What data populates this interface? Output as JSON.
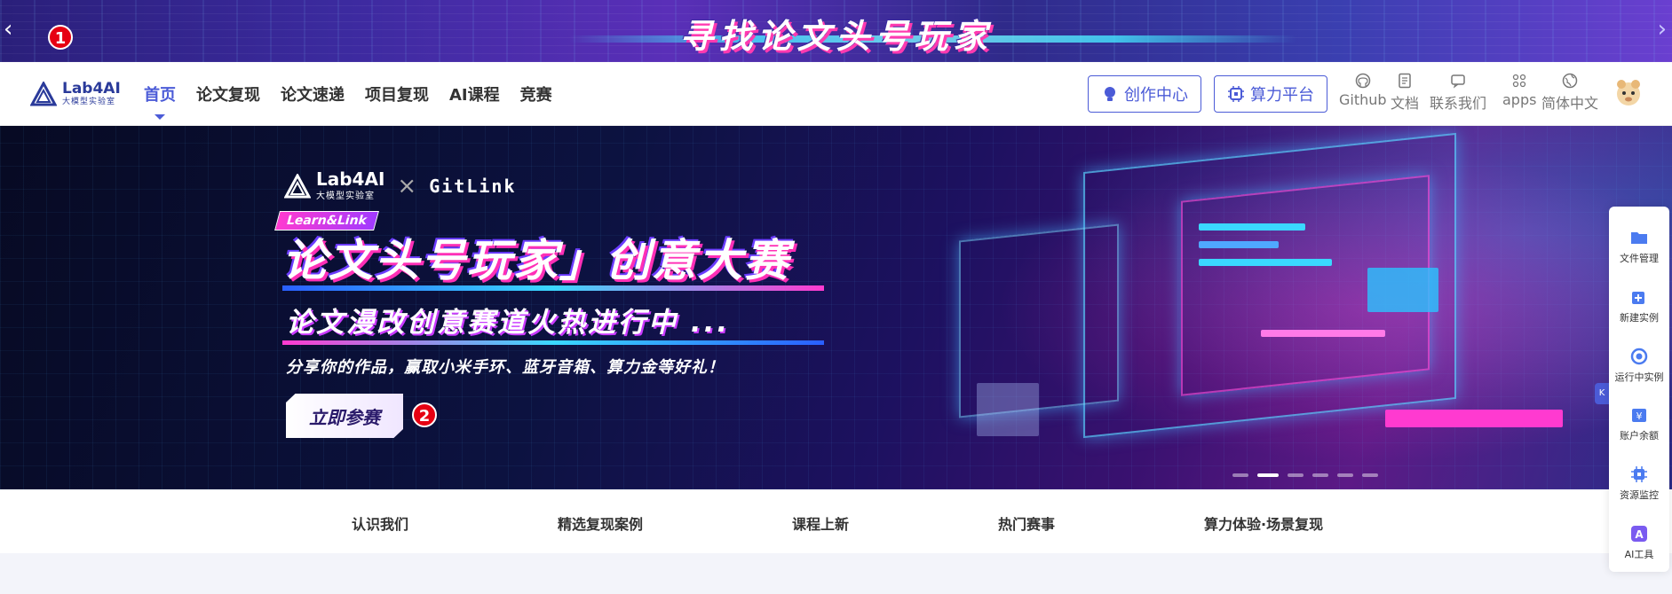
{
  "promo": {
    "title": "寻找论文头号玩家",
    "prev_icon": "chevron-left-icon",
    "next_icon": "chevron-right-icon",
    "badge": "1"
  },
  "nav": {
    "logo": {
      "name": "Lab4AI",
      "sub": "大模型实验室"
    },
    "menu": [
      {
        "label": "首页",
        "active": true
      },
      {
        "label": "论文复现"
      },
      {
        "label": "论文速递"
      },
      {
        "label": "项目复现"
      },
      {
        "label": "AI课程"
      },
      {
        "label": "竞赛"
      }
    ],
    "buttons": {
      "creator": "创作中心",
      "compute": "算力平台"
    },
    "tools": {
      "github": "Github",
      "docs": "文档",
      "contact": "联系我们",
      "apps": "apps",
      "lang": "简体中文"
    }
  },
  "hero": {
    "brand_name": "Lab4AI",
    "brand_sub": "大模型实验室",
    "times": "×",
    "gitlink_mark": "GitLink",
    "tag": "Learn&Link",
    "title": "论文头号玩家」创意大赛",
    "subtitle": "论文漫改创意赛道火热进行中 ...",
    "desc": "分享你的作品，赢取小米手环、蓝牙音箱、算力金等好礼！",
    "cta": "立即参赛",
    "badge": "2",
    "slides": 6,
    "active_slide": 2
  },
  "strip": [
    "认识我们",
    "精选复现案例",
    "课程上新",
    "热门赛事",
    "算力体验·场景复现"
  ],
  "float_bar": {
    "fold_label": "K",
    "items": [
      {
        "label": "文件管理",
        "icon": "folder-icon"
      },
      {
        "label": "新建实例",
        "icon": "add-instance-icon"
      },
      {
        "label": "运行中实例",
        "icon": "running-instance-icon"
      },
      {
        "label": "账户余额",
        "icon": "wallet-icon"
      },
      {
        "label": "资源监控",
        "icon": "chip-monitor-icon"
      },
      {
        "label": "AI工具",
        "icon": "ai-tool-icon"
      }
    ]
  },
  "colors": {
    "accent": "#4b5bd7",
    "badge": "#e60012",
    "hero_pink": "#ff2fb6"
  }
}
